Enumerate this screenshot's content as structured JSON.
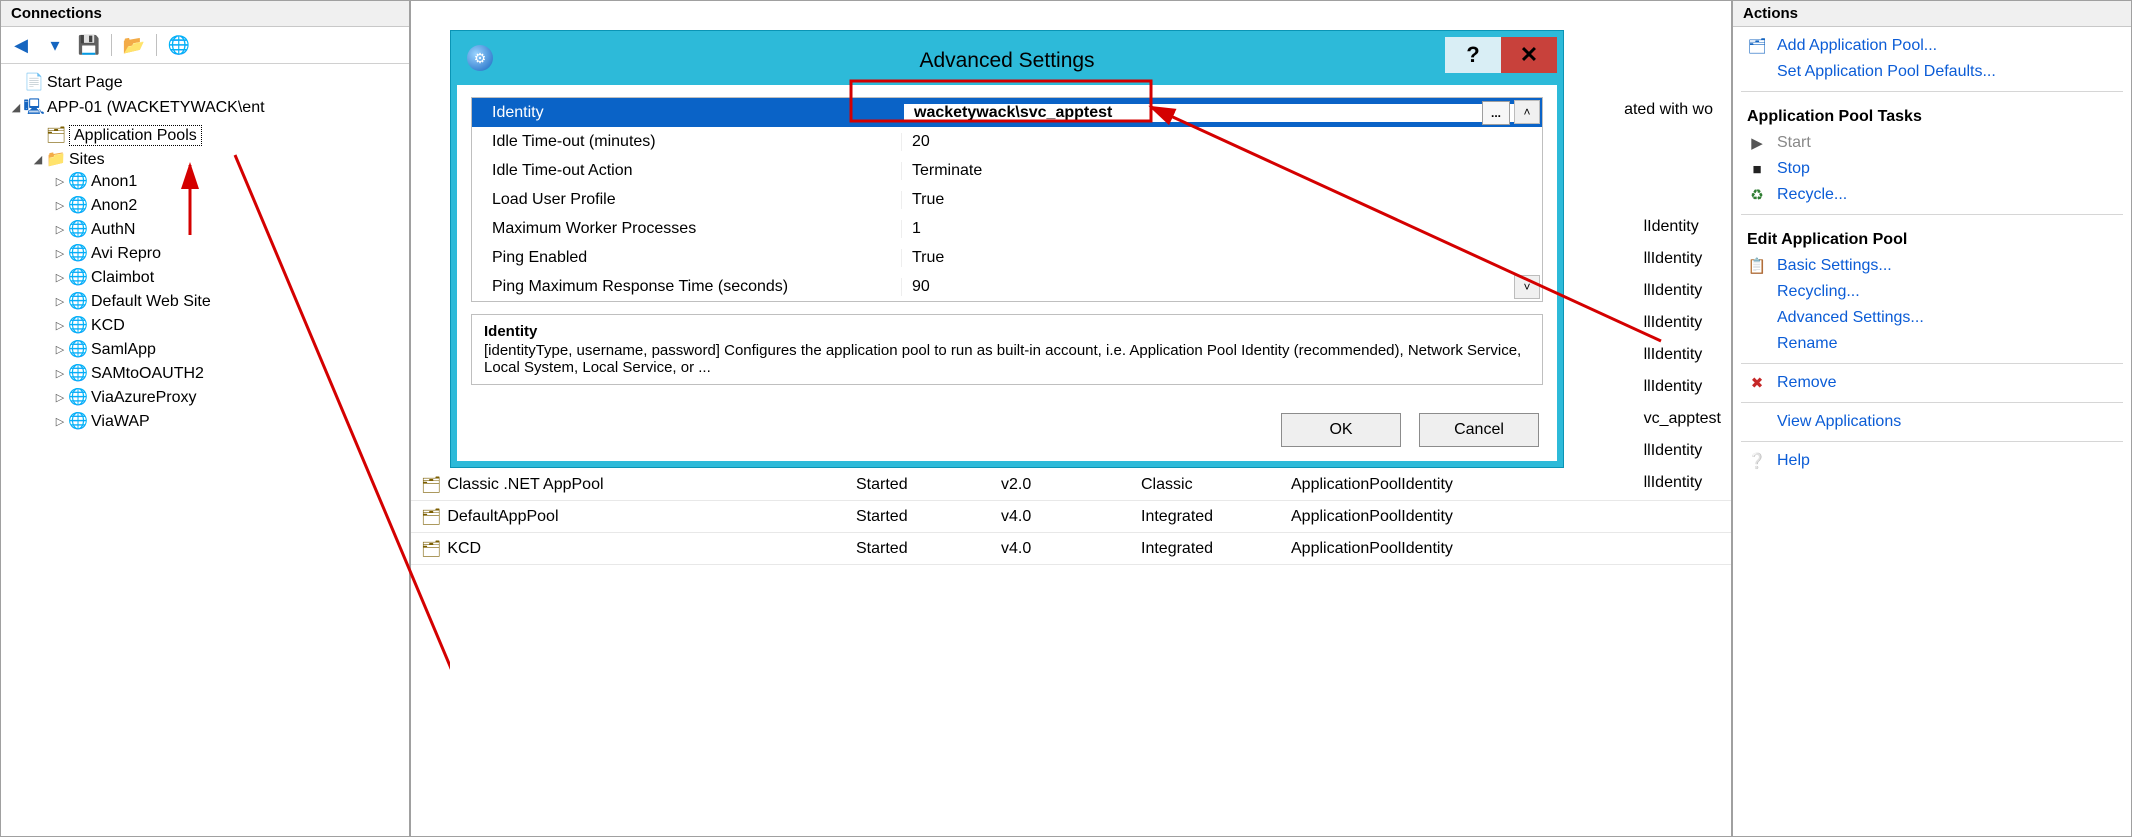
{
  "connections": {
    "title": "Connections",
    "toolbar_icons": [
      "back-icon",
      "menu-dropdown-icon",
      "save-icon",
      "open-folder-icon",
      "stop-server-icon"
    ],
    "tree": {
      "root": "Start Page",
      "server": "APP-01 (WACKETYWACK\\ent",
      "nodes": [
        "Application Pools",
        "Sites"
      ],
      "sites": [
        "Anon1",
        "Anon2",
        "AuthN",
        "Avi Repro",
        "Claimbot",
        "Default Web Site",
        "KCD",
        "SamlApp",
        "SAMtoOAUTH2",
        "ViaAzureProxy",
        "ViaWAP"
      ]
    }
  },
  "dialog": {
    "title": "Advanced Settings",
    "rows": [
      {
        "k": "Identity",
        "v": "wacketywack\\svc_apptest",
        "selected": true
      },
      {
        "k": "Idle Time-out (minutes)",
        "v": "20"
      },
      {
        "k": "Idle Time-out Action",
        "v": "Terminate"
      },
      {
        "k": "Load User Profile",
        "v": "True"
      },
      {
        "k": "Maximum Worker Processes",
        "v": "1"
      },
      {
        "k": "Ping Enabled",
        "v": "True"
      },
      {
        "k": "Ping Maximum Response Time (seconds)",
        "v": "90"
      }
    ],
    "desc_title": "Identity",
    "desc_body": "[identityType, username, password] Configures the application pool to run as built-in account, i.e. Application Pool Identity (recommended), Network Service, Local System, Local Service, or ...",
    "ok": "OK",
    "cancel": "Cancel",
    "ellipsis": "..."
  },
  "grid": {
    "assoc_text": "ated with wo",
    "right_identities": [
      "lIdentity",
      "llIdentity",
      "llIdentity",
      "llIdentity",
      "llIdentity",
      "llIdentity",
      "vc_apptest",
      "llIdentity",
      "llIdentity"
    ],
    "rows": [
      {
        "name": "Classic .NET AppPool",
        "status": "Started",
        "clr": "v2.0",
        "pipeline": "Classic",
        "identity": "ApplicationPoolIdentity"
      },
      {
        "name": "DefaultAppPool",
        "status": "Started",
        "clr": "v4.0",
        "pipeline": "Integrated",
        "identity": "ApplicationPoolIdentity"
      },
      {
        "name": "KCD",
        "status": "Started",
        "clr": "v4.0",
        "pipeline": "Integrated",
        "identity": "ApplicationPoolIdentity"
      }
    ]
  },
  "actions": {
    "title": "Actions",
    "add": "Add Application Pool...",
    "defaults": "Set Application Pool Defaults...",
    "section_tasks": "Application Pool Tasks",
    "start": "Start",
    "stop": "Stop",
    "recycle": "Recycle...",
    "section_edit": "Edit Application Pool",
    "basic": "Basic Settings...",
    "recycling": "Recycling...",
    "advanced": "Advanced Settings...",
    "rename": "Rename",
    "remove": "Remove",
    "view": "View Applications",
    "help": "Help"
  }
}
